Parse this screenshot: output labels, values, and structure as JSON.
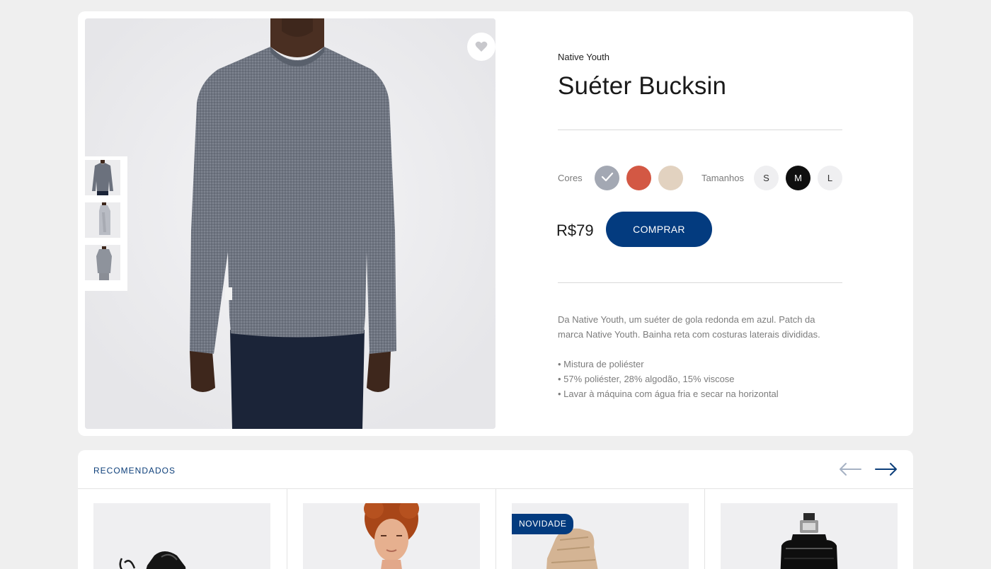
{
  "product": {
    "brand": "Native Youth",
    "title": "Suéter Bucksin",
    "favorite_icon": "heart-icon",
    "colors_label": "Cores",
    "sizes_label": "Tamanhos",
    "colors": [
      {
        "name": "gray",
        "hex": "#a3a8b3",
        "selected": true
      },
      {
        "name": "red",
        "hex": "#d35844",
        "selected": false
      },
      {
        "name": "beige",
        "hex": "#e2d2c0",
        "selected": false
      }
    ],
    "sizes": [
      {
        "label": "S",
        "selected": false
      },
      {
        "label": "M",
        "selected": true
      },
      {
        "label": "L",
        "selected": false
      }
    ],
    "price": "R$79",
    "buy_label": "COMPRAR",
    "description": "Da Native Youth, um suéter de gola redonda em azul. Patch da marca Native Youth. Bainha reta com costuras laterais divididas.",
    "features": [
      "• Mistura de poliéster",
      "• 57% poliéster, 28% algodão, 15% viscose",
      "• Lavar à máquina com água fria e secar na horizontal"
    ]
  },
  "recommended": {
    "title": "RECOMENDADOS",
    "prev_icon": "arrow-left-icon",
    "next_icon": "arrow-right-icon",
    "badge": "NOVIDADE"
  },
  "colors": {
    "accent": "#033b7f",
    "background": "#efefef"
  }
}
